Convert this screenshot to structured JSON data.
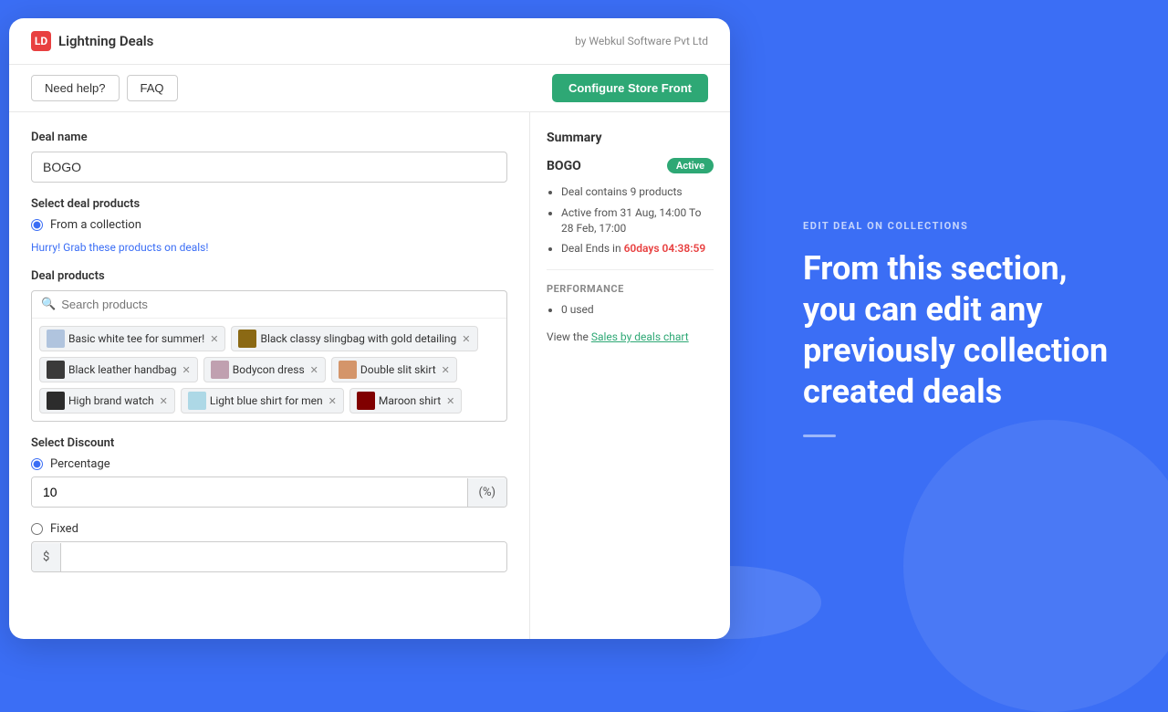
{
  "app": {
    "logo_text": "LD",
    "brand_name": "Lightning Deals",
    "by_text": "by Webkul Software Pvt Ltd"
  },
  "toolbar": {
    "need_help": "Need help?",
    "faq": "FAQ",
    "configure_btn": "Configure Store Front"
  },
  "form": {
    "deal_name_label": "Deal name",
    "deal_name_value": "BOGO",
    "select_products_label": "Select deal products",
    "from_collection_label": "From a collection",
    "hurry_link": "Hurry! Grab these products on deals!",
    "deal_products_label": "Deal products",
    "search_placeholder": "Search products",
    "products": [
      {
        "name": "Basic white tee for summer!",
        "thumb_class": "thumb-tee"
      },
      {
        "name": "Black classy slingbag with gold detailing",
        "thumb_class": "thumb-sling"
      },
      {
        "name": "Black leather handbag",
        "thumb_class": "thumb-handbag"
      },
      {
        "name": "Bodycon dress",
        "thumb_class": "thumb-bodycon"
      },
      {
        "name": "Double slit skirt",
        "thumb_class": "thumb-skirt"
      },
      {
        "name": "High brand watch",
        "thumb_class": "thumb-watch"
      },
      {
        "name": "Light blue shirt for men",
        "thumb_class": "thumb-shirt"
      },
      {
        "name": "Maroon shirt",
        "thumb_class": "thumb-maroon"
      }
    ],
    "select_discount_label": "Select Discount",
    "percentage_label": "Percentage",
    "percentage_value": "10",
    "percentage_suffix": "(%)",
    "fixed_label": "Fixed",
    "fixed_prefix": "$"
  },
  "summary": {
    "title": "Summary",
    "deal_name": "BOGO",
    "status": "Active",
    "bullet1": "Deal contains 9 products",
    "bullet2": "Active from 31 Aug, 14:00 To 28 Feb, 17:00",
    "bullet3_prefix": "Deal Ends in",
    "deal_ends_time": "60days 04:38:59",
    "performance_label": "PERFORMANCE",
    "used_text": "0 used",
    "view_chart_prefix": "View the",
    "chart_link": "Sales by deals chart"
  },
  "right_panel": {
    "subtitle": "EDIT DEAL ON COLLECTIONS",
    "heading": "From this section, you can edit any previously collection created deals"
  }
}
